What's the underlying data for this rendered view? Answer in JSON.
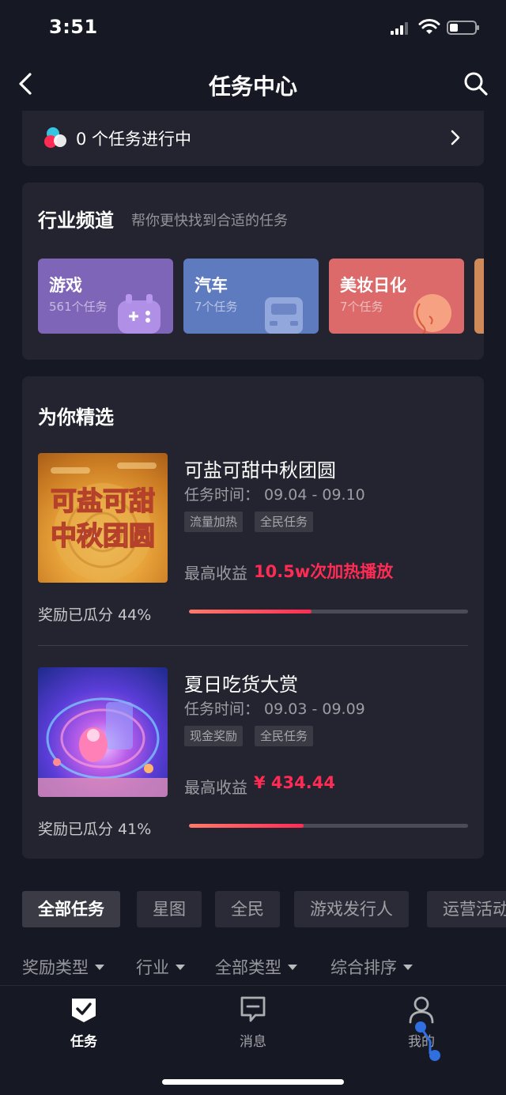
{
  "status_bar": {
    "time": "3:51"
  },
  "header": {
    "title": "任务中心"
  },
  "task_progress": {
    "text": "0 个任务进行中"
  },
  "industry": {
    "title": "行业频道",
    "subtitle": "帮你更快找到合适的任务",
    "categories": [
      {
        "name": "游戏",
        "count": "561个任务",
        "color": "#7e65b8"
      },
      {
        "name": "汽车",
        "count": "7个任务",
        "color": "#5f7bc0"
      },
      {
        "name": "美妆日化",
        "count": "7个任务",
        "color": "#dc6a6a"
      }
    ]
  },
  "featured": {
    "title": "为你精选",
    "items": [
      {
        "name": "可盐可甜中秋团圆",
        "time": "任务时间： 09.04 - 09.10",
        "tags": [
          "流量加热",
          "全民任务"
        ],
        "max_label": "最高收益",
        "max_value": "10.5w次加热播放",
        "share_label": "奖励已瓜分 44%",
        "progress": 0.44,
        "thumb_text_1": "可盐可甜",
        "thumb_text_2": "中秋团圆"
      },
      {
        "name": "夏日吃货大赏",
        "time": "任务时间： 09.03 - 09.09",
        "tags": [
          "现金奖励",
          "全民任务"
        ],
        "max_label": "最高收益",
        "max_value": "¥ 434.44",
        "share_label": "奖励已瓜分 41%",
        "progress": 0.41
      }
    ]
  },
  "filters": [
    "全部任务",
    "星图",
    "全民",
    "游戏发行人",
    "运营活动"
  ],
  "sort": [
    "奖励类型",
    "行业",
    "全部类型",
    "综合排序"
  ],
  "tabs": [
    {
      "label": "任务",
      "icon": "task-check-icon"
    },
    {
      "label": "消息",
      "icon": "message-icon"
    },
    {
      "label": "我的",
      "icon": "profile-icon"
    }
  ],
  "colors": {
    "accent": "#fe2c55",
    "background": "#161823",
    "card": "#23242f"
  }
}
